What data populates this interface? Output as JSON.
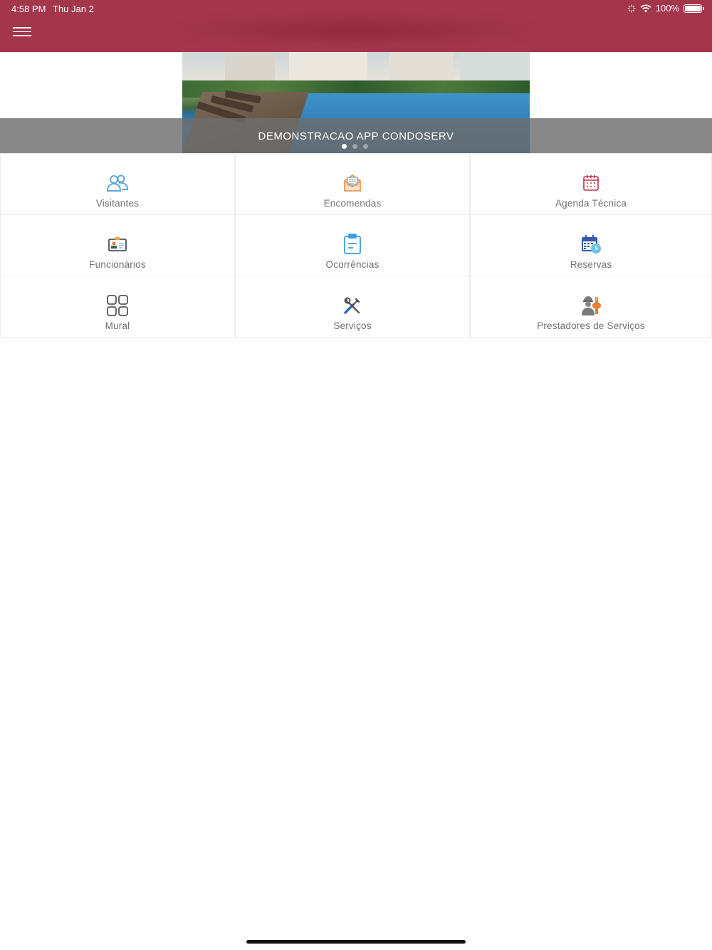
{
  "status_bar": {
    "time": "4:58 PM",
    "date": "Thu Jan 2",
    "battery": "100%",
    "icons": [
      "activity-icon",
      "wifi-icon",
      "battery-icon"
    ]
  },
  "nav": {
    "menu_icon": "hamburger-menu-icon",
    "bar_color": "#a3364b"
  },
  "banner": {
    "title": "DEMONSTRACAO APP CONDOSERV",
    "pages": 3,
    "active_page": 1
  },
  "tiles": [
    {
      "label": "Visitantes",
      "icon": "visitors-icon",
      "color": "#5ba7dd"
    },
    {
      "label": "Encomendas",
      "icon": "package-mail-icon",
      "color": "#f08a3c"
    },
    {
      "label": "Agenda Técnica",
      "icon": "calendar-icon",
      "color": "#c0304a"
    },
    {
      "label": "Funcionários",
      "icon": "id-card-icon",
      "color": "#2f6b57"
    },
    {
      "label": "Ocorrências",
      "icon": "clipboard-icon",
      "color": "#3a9ee0"
    },
    {
      "label": "Reservas",
      "icon": "calendar-clock-icon",
      "color": "#2f5aa8"
    },
    {
      "label": "Mural",
      "icon": "grid-icon",
      "color": "#555555"
    },
    {
      "label": "Serviços",
      "icon": "tools-icon",
      "color": "#2c6fb0"
    },
    {
      "label": "Prestadores de Serviços",
      "icon": "worker-icon",
      "color": "#f0792b"
    }
  ]
}
